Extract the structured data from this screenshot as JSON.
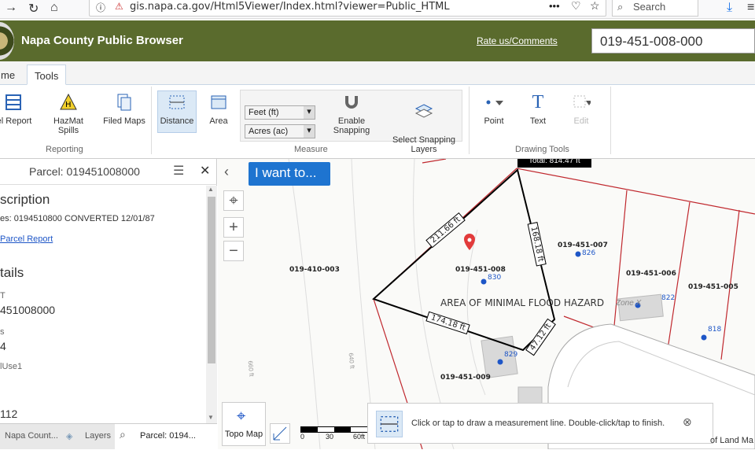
{
  "browser": {
    "url": "gis.napa.ca.gov/Html5Viewer/Index.html?viewer=Public_HTML",
    "search_placeholder": "Search"
  },
  "header": {
    "title": "Napa County Public Browser",
    "rate_link": "Rate us/Comments",
    "parcel_search_value": "019-451-008-000"
  },
  "tabs": [
    {
      "label": "me"
    },
    {
      "label": "Tools"
    }
  ],
  "ribbon": {
    "reporting": {
      "label": "Reporting",
      "items": [
        "el Report",
        "HazMat Spills",
        "Filed Maps"
      ]
    },
    "measure": {
      "label": "Measure",
      "distance": "Distance",
      "area": "Area",
      "unit_length": "Feet (ft)",
      "unit_area": "Acres (ac)",
      "enable_snapping": "Enable Snapping",
      "select_snapping": "Select Snapping\nLayers"
    },
    "drawing": {
      "label": "Drawing Tools",
      "point": "Point",
      "text": "Text",
      "edit": "Edit"
    }
  },
  "panel": {
    "title": "Parcel: 019451008000",
    "section_description": "scription",
    "notes_line": "es: 0194510800 CONVERTED 12/01/87",
    "report_link": "Parcel Report",
    "section_details": "tails",
    "field1_label": "T",
    "field1_value": "451008000",
    "field2_label": "s",
    "field2_value": "4",
    "field3_label": "lUse1",
    "field4_value": "112"
  },
  "bottom_tabs": [
    "Napa Count...",
    "Layers",
    "Parcel: 0194..."
  ],
  "map": {
    "i_want_to": "I want to...",
    "total": "Total: 814.47 ft",
    "segments": [
      "211.66 ft",
      "168.18 ft",
      "174.18 ft",
      "47.12 ft"
    ],
    "parcels": [
      "019-410-003",
      "019-451-008",
      "019-451-007",
      "019-451-006",
      "019-451-005",
      "019-451-009"
    ],
    "addresses": [
      "830",
      "826",
      "822",
      "818",
      "829"
    ],
    "flood_label": "AREA OF MINIMAL FLOOD HAZARD",
    "zone_label": "Zone X",
    "contours": [
      "660 ft",
      "640 ft"
    ],
    "topo_label": "Topo Map",
    "scale": [
      "0",
      "30",
      "60ft"
    ],
    "hint": "Click or tap to draw a measurement line. Double-click/tap to finish.",
    "attribution": "of Land Ma"
  },
  "colors": {
    "header": "#5a6b2d",
    "accent": "#1e74d0",
    "parcel_line": "#c0282e"
  }
}
